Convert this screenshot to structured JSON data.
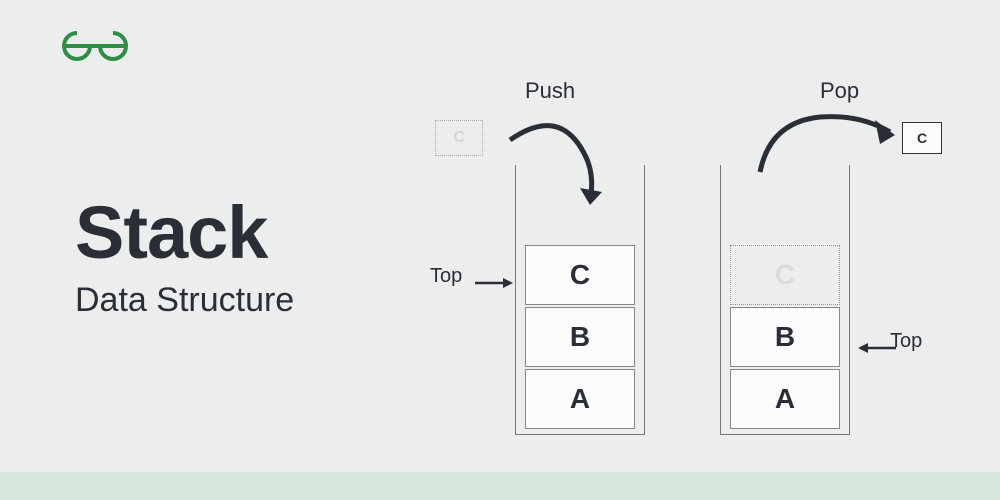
{
  "logo_name": "geeksforgeeks-logo",
  "title": "Stack",
  "subtitle": "Data Structure",
  "operations": {
    "push": "Push",
    "pop": "Pop"
  },
  "left_stack": {
    "ghost_incoming": "C",
    "cells": [
      "C",
      "B",
      "A"
    ],
    "top_label": "Top"
  },
  "right_stack": {
    "outgoing": "C",
    "ghost_cell": "C",
    "cells": [
      "B",
      "A"
    ],
    "top_label": "Top"
  },
  "colors": {
    "brand": "#2f8d46",
    "text": "#2a2e36",
    "bg": "#eceded",
    "footer": "#d6e8de"
  }
}
